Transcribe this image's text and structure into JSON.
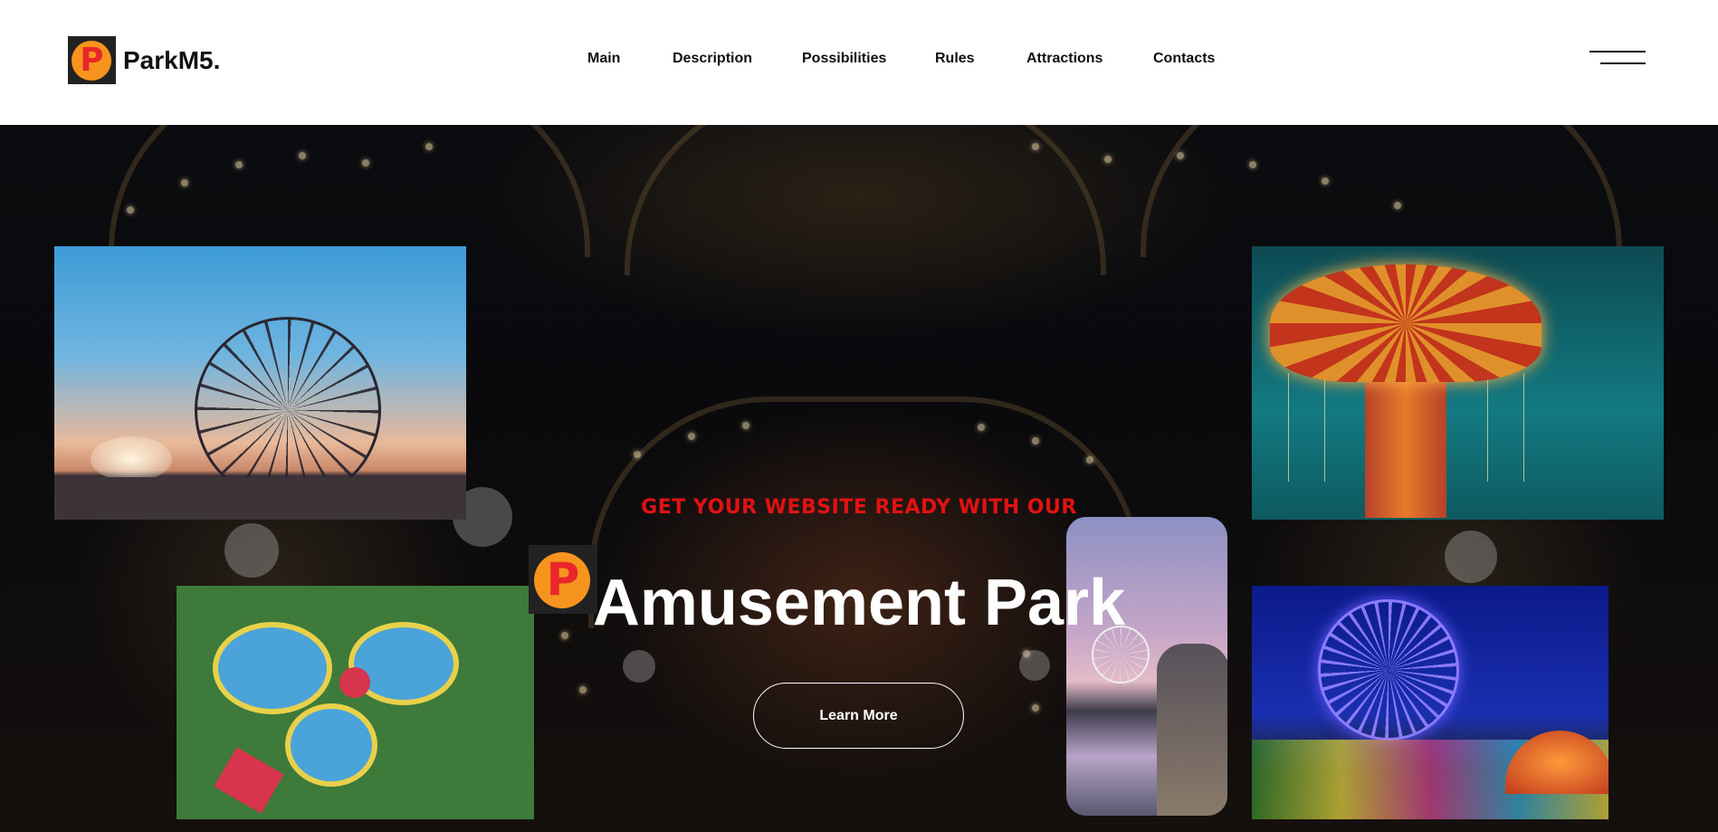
{
  "header": {
    "logo_letter": "P",
    "brand": "ParkM5.",
    "nav": [
      "Main",
      "Description",
      "Possibilities",
      "Rules",
      "Attractions",
      "Contacts"
    ],
    "menu_icon": "hamburger-icon"
  },
  "hero": {
    "eyebrow": "GET YOUR WEBSITE READY WITH OUR",
    "title": "Amusement Park",
    "cta": "Learn More",
    "badge_letter": "P",
    "images": [
      "ferris-wheel-sunset",
      "chair-swing-ride",
      "water-park-aerial",
      "pier-ferris-wheel-girl",
      "night-ferris-wheel"
    ]
  },
  "colors": {
    "accent_red": "#e11212",
    "logo_orange": "#f7941d",
    "header_bg": "#ffffff",
    "hero_bg": "#0b0c0f"
  }
}
